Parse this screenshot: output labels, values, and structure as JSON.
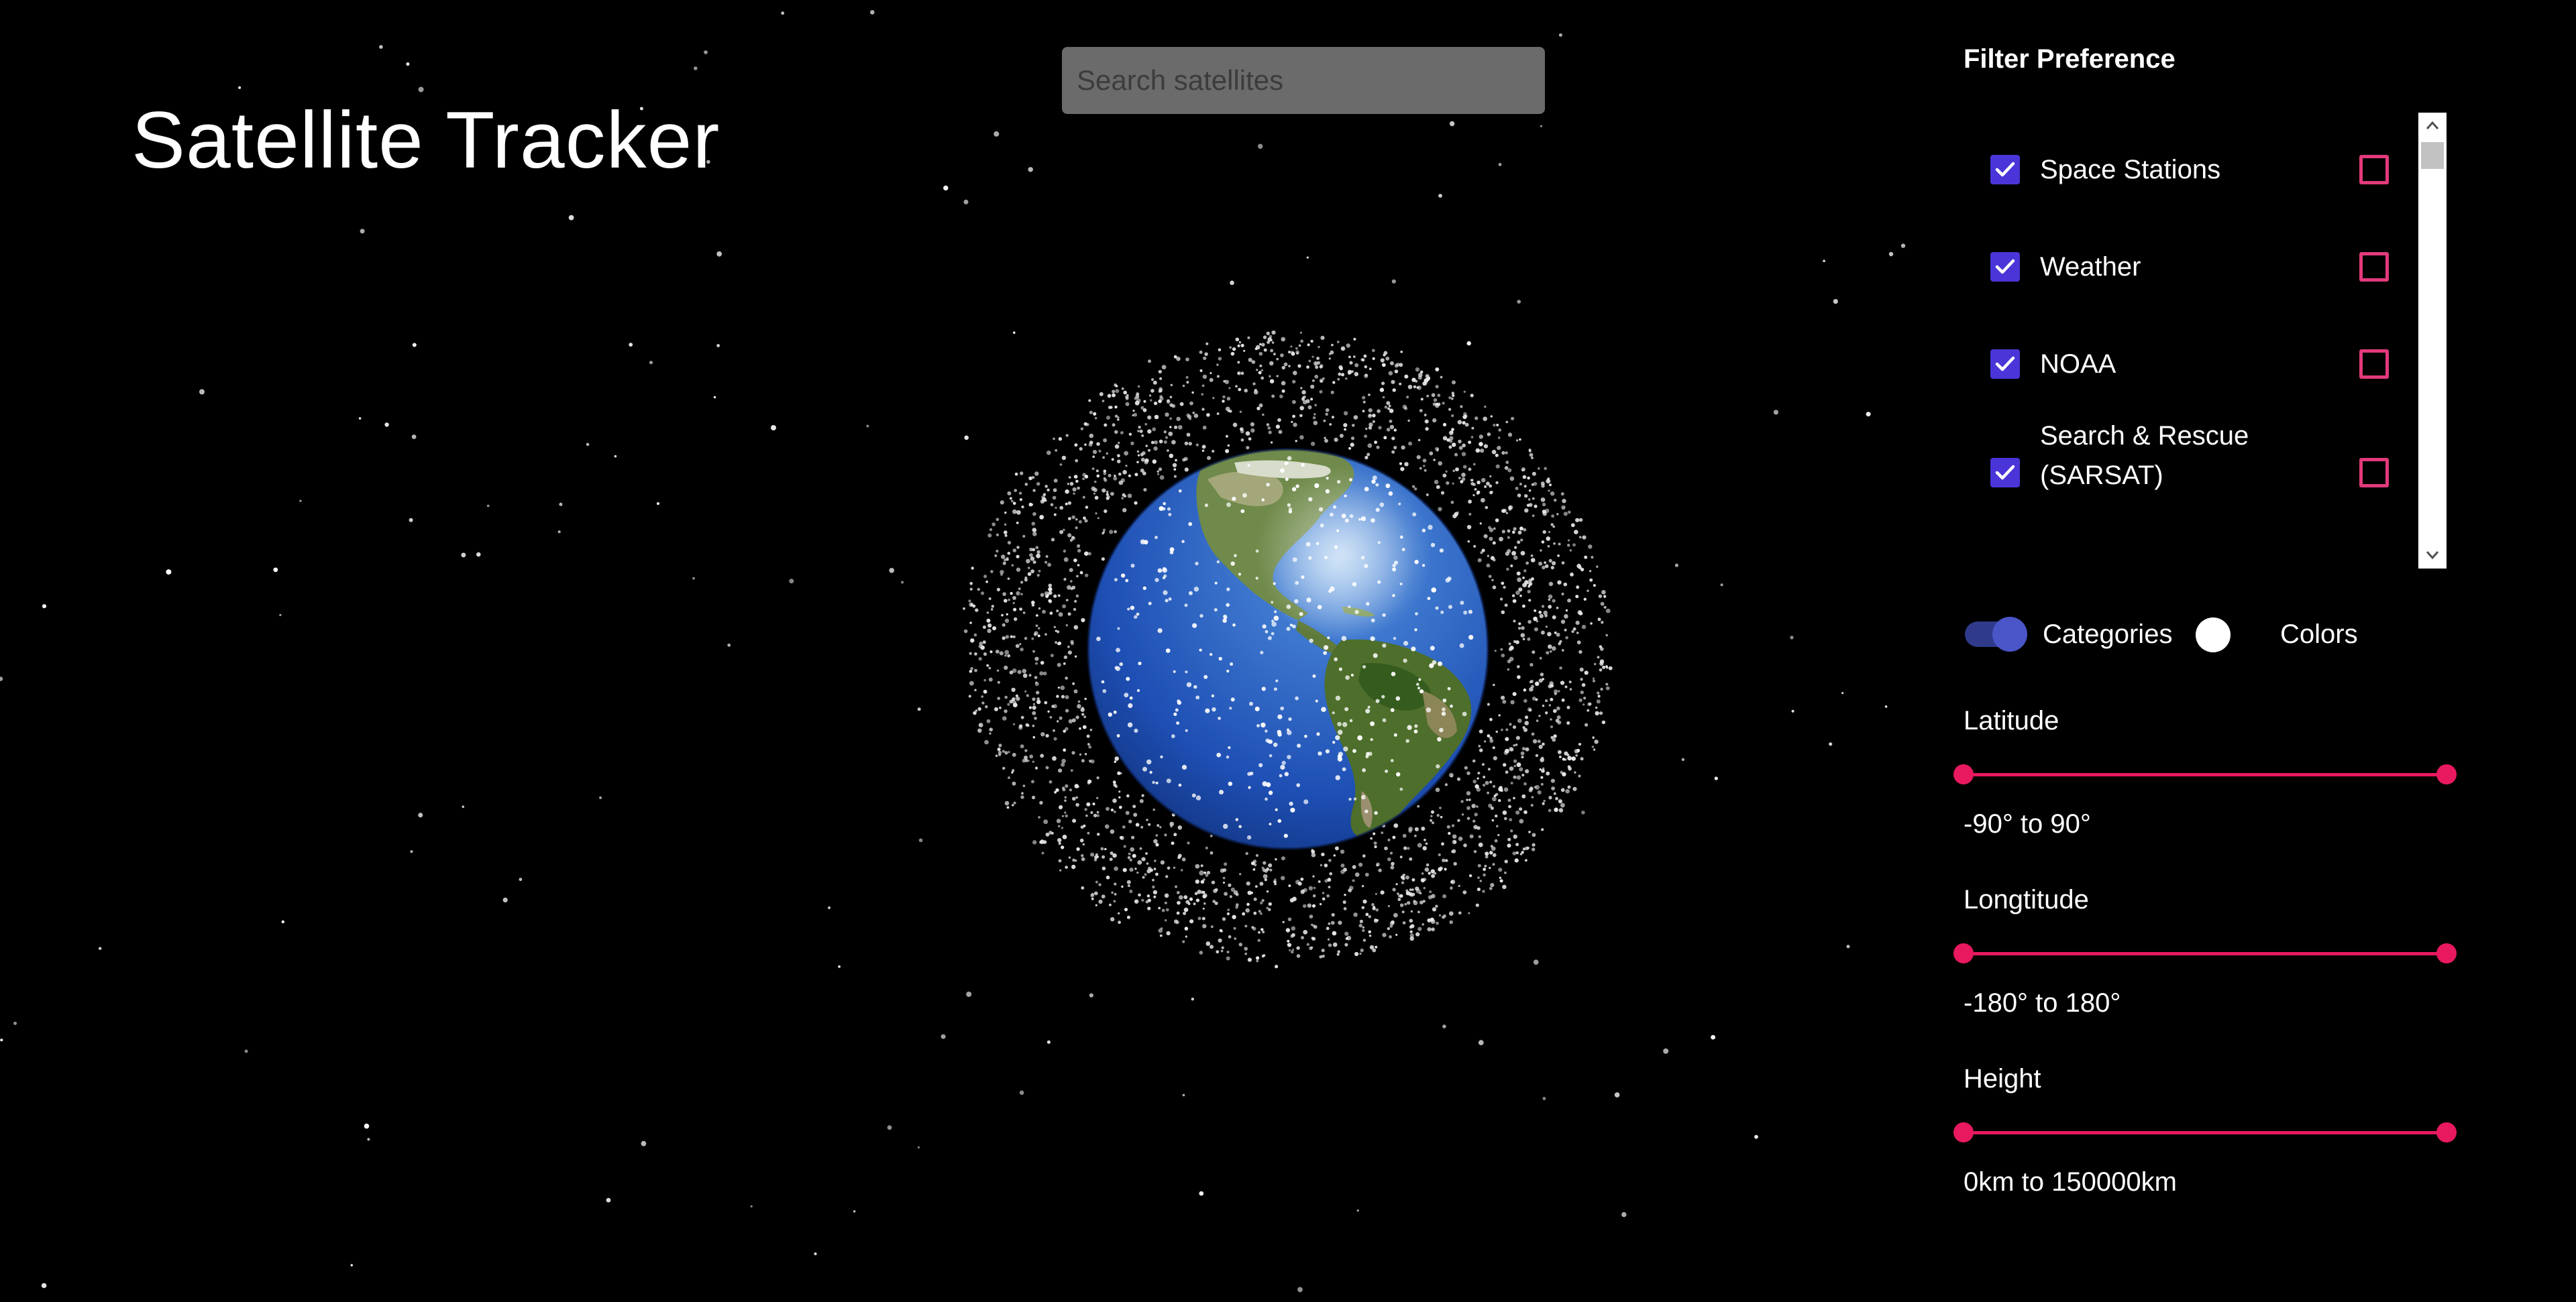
{
  "app": {
    "title": "Satellite Tracker"
  },
  "search": {
    "placeholder": "Search satellites",
    "value": ""
  },
  "filter_panel": {
    "heading": "Filter Preference",
    "items": [
      {
        "label": "Space Stations",
        "checked": true,
        "color_checked": false
      },
      {
        "label": "Weather",
        "checked": true,
        "color_checked": false
      },
      {
        "label": "NOAA",
        "checked": true,
        "color_checked": false
      },
      {
        "label_line1": "Search & Rescue",
        "label_line2": "(SARSAT)",
        "checked": true,
        "color_checked": false
      }
    ],
    "toggle": {
      "left_label": "Categories",
      "right_label": "Colors",
      "on": true
    },
    "sliders": [
      {
        "label": "Latitude",
        "range_text": "-90° to 90°",
        "min": -90,
        "max": 90,
        "low": -90,
        "high": 90
      },
      {
        "label": "Longtitude",
        "range_text": "-180° to 180°",
        "min": -180,
        "max": 180,
        "low": -180,
        "high": 180
      },
      {
        "label": "Height",
        "range_text": "0km to 150000km",
        "min": 0,
        "max": 150000,
        "low": 0,
        "high": 150000
      }
    ]
  },
  "colors": {
    "background": "#000000",
    "checkbox_checked": "#4a35d8",
    "checkbox_unchecked_border": "#e23a7c",
    "slider": "#e8195f",
    "toggle_track": "#2f3b8a",
    "toggle_knob": "#4a55c8",
    "search_bg": "#6b6b6b"
  },
  "icons": {
    "checkmark": "check-icon",
    "scroll_up": "chevron-up-icon",
    "scroll_down": "chevron-down-icon"
  }
}
